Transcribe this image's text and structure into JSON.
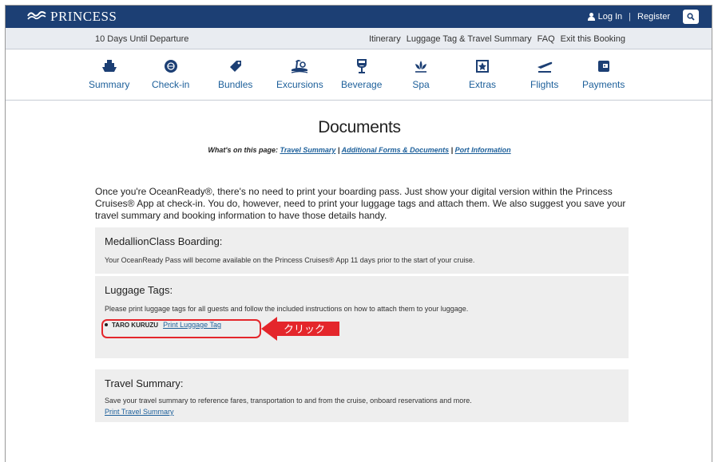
{
  "header": {
    "brand": "PRINCESS",
    "login": "Log In",
    "separator": "|",
    "register": "Register"
  },
  "subbar": {
    "departure": "10 Days Until Departure",
    "links": [
      "Itinerary",
      "Luggage Tag & Travel Summary",
      "FAQ",
      "Exit this Booking"
    ]
  },
  "nav": {
    "items": [
      {
        "label": "Summary",
        "icon": "ship-icon"
      },
      {
        "label": "Check-in",
        "icon": "passport-icon"
      },
      {
        "label": "Bundles",
        "icon": "tag-icon"
      },
      {
        "label": "Excursions",
        "icon": "palm-island-icon"
      },
      {
        "label": "Beverage",
        "icon": "wine-glass-icon"
      },
      {
        "label": "Spa",
        "icon": "lotus-icon"
      },
      {
        "label": "Extras",
        "icon": "star-box-icon"
      },
      {
        "label": "Flights",
        "icon": "plane-icon"
      },
      {
        "label": "Payments",
        "icon": "wallet-icon"
      }
    ]
  },
  "page": {
    "title": "Documents",
    "onpage_label": "What's on this page:",
    "onpage_links": [
      "Travel Summary",
      "Additional Forms & Documents",
      "Port Information"
    ],
    "onpage_sep": "|",
    "intro": "Once you're OceanReady®, there's no need to print your boarding pass. Just show your digital version within the Princess Cruises® App at check-in. You do, however, need to print your luggage tags and attach them. We also suggest you save your travel summary and booking information to have those details handy."
  },
  "panels": {
    "medallion": {
      "title": "MedallionClass Boarding:",
      "text": "Your OceanReady Pass will become available on the Princess Cruises® App 11 days prior to the start of your cruise."
    },
    "luggage": {
      "title": "Luggage Tags:",
      "text": "Please print luggage tags for all guests and follow the included instructions on how to attach them to your luggage.",
      "guest_name": "TARO KURUZU",
      "print_link": "Print Luggage Tag"
    },
    "travel": {
      "title": "Travel Summary:",
      "text": "Save your travel summary to reference fares, transportation to and from the cruise, onboard reservations and more.",
      "print_link": "Print Travel Summary"
    }
  },
  "annotation": {
    "label": "クリック",
    "color": "#e4262b"
  },
  "colors": {
    "brand_navy": "#1c3f74",
    "link_blue": "#1c5f9a",
    "panel_bg": "#eeeeee"
  }
}
